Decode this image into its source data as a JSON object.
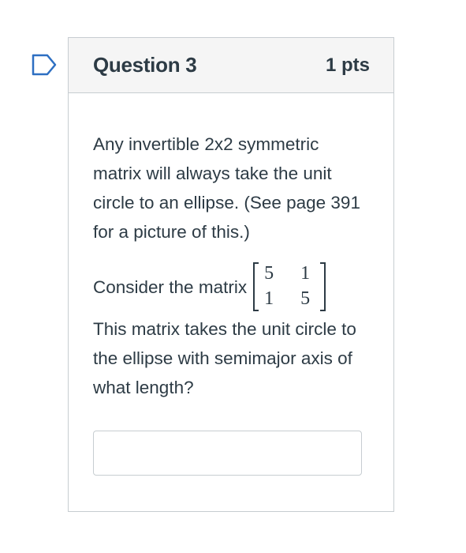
{
  "question": {
    "title": "Question 3",
    "points": "1 pts",
    "paragraph1": "Any invertible 2x2 symmetric matrix will always take the unit circle to an ellipse. (See page 391 for a picture of this.)",
    "consider_label": "Consider the matrix",
    "matrix": [
      [
        "5",
        "1"
      ],
      [
        "1",
        "5"
      ]
    ],
    "paragraph2": "This matrix takes the unit circle to the ellipse with semimajor axis of what length?",
    "answer_value": ""
  },
  "icons": {
    "flag": "bookmark-flag-icon"
  },
  "colors": {
    "flag": "#2d6fc2",
    "text": "#2d3b45",
    "header_bg": "#f5f5f5",
    "border": "#c7cdd1"
  }
}
